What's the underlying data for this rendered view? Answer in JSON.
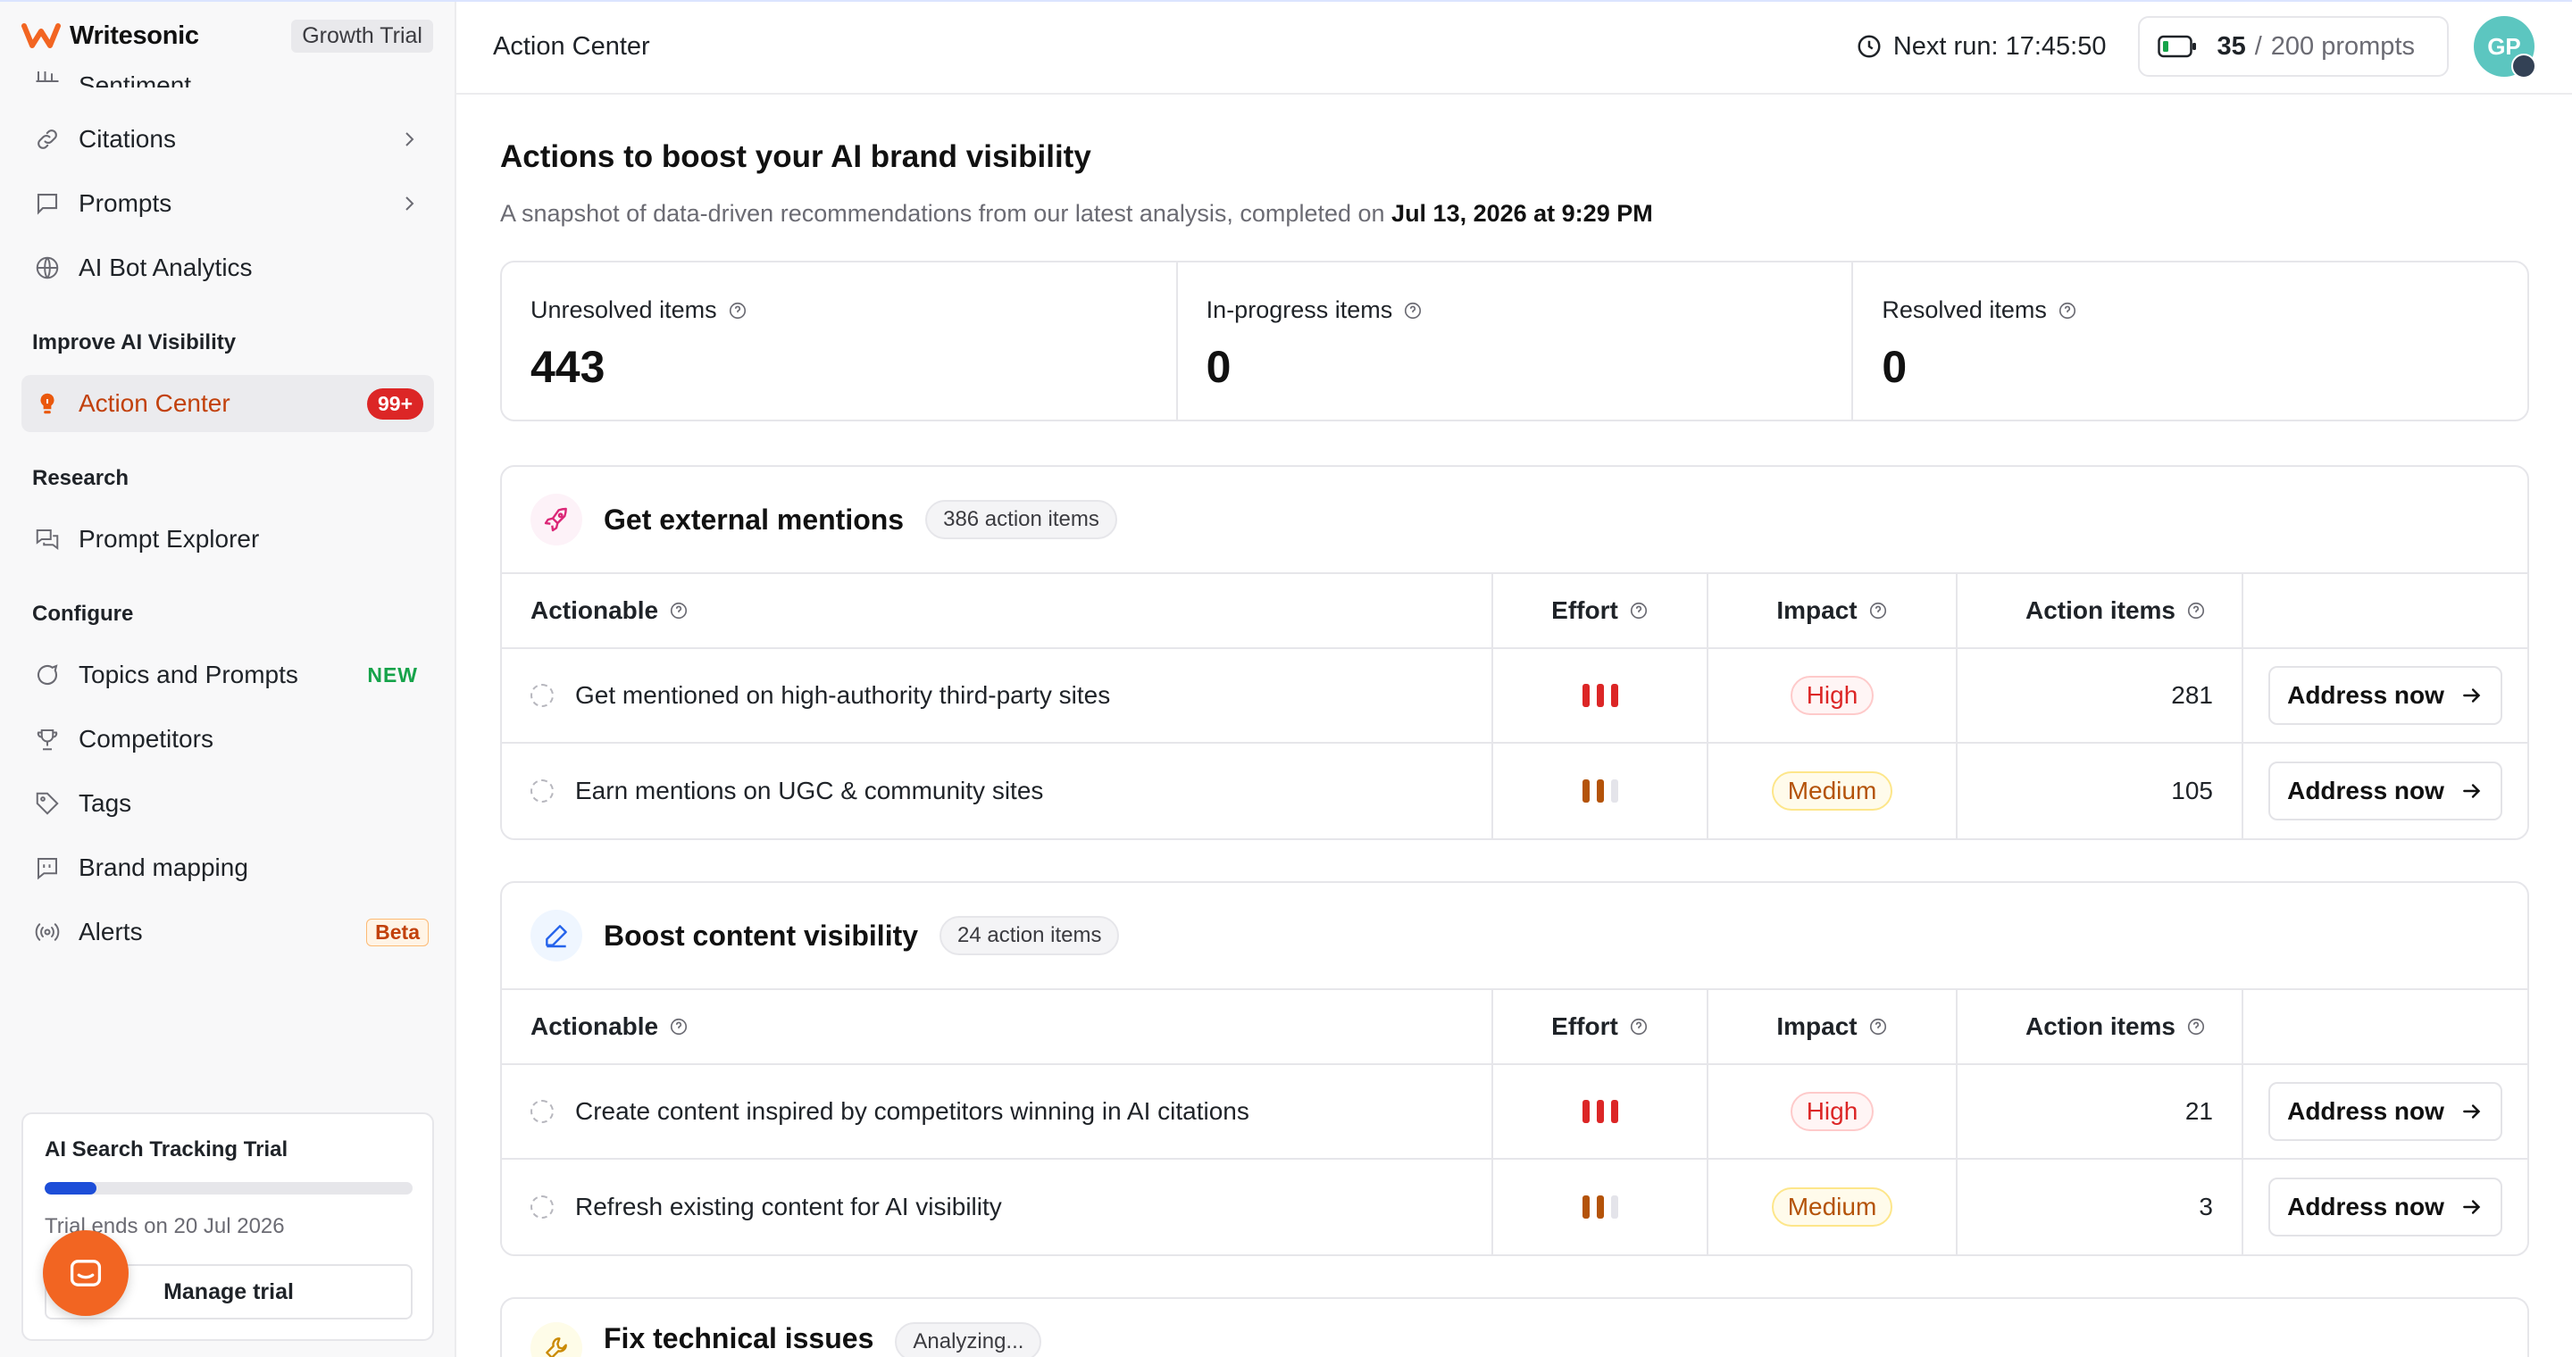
{
  "brand": {
    "name": "Writesonic",
    "plan": "Growth Trial",
    "accent": "#f26522"
  },
  "sidebar": {
    "items_top": [
      {
        "label": "Sentiment",
        "icon": "sentiment-icon"
      },
      {
        "label": "Citations",
        "icon": "link-icon"
      },
      {
        "label": "Prompts",
        "icon": "message-square-icon"
      },
      {
        "label": "AI Bot Analytics",
        "icon": "globe-icon"
      }
    ],
    "sections": {
      "improve": "Improve AI Visibility",
      "research": "Research",
      "configure": "Configure"
    },
    "action_center": {
      "label": "Action Center",
      "badge": "99+"
    },
    "prompt_explorer": {
      "label": "Prompt Explorer"
    },
    "configure_items": {
      "topics": {
        "label": "Topics and Prompts",
        "tag": "NEW"
      },
      "competitors": {
        "label": "Competitors"
      },
      "tags": {
        "label": "Tags"
      },
      "brand_mapping": {
        "label": "Brand mapping"
      },
      "alerts": {
        "label": "Alerts",
        "tag": "Beta"
      }
    },
    "trial": {
      "title": "AI Search Tracking Trial",
      "progress": 0.14,
      "ends": "Trial ends on 20 Jul 2026",
      "button": "Manage trial"
    }
  },
  "topbar": {
    "title": "Action Center",
    "next_run": "Next run: 17:45:50",
    "prompts_used": "35",
    "prompts_sep": "/",
    "prompts_total": "200 prompts",
    "avatar_initials": "GP"
  },
  "main": {
    "heading": "Actions to boost your AI brand visibility",
    "subtitle": "A snapshot of data-driven recommendations from our latest analysis, completed on",
    "completed_on": "Jul 13, 2026 at 9:29 PM",
    "stats": [
      {
        "label": "Unresolved items",
        "value": "443"
      },
      {
        "label": "In-progress items",
        "value": "0"
      },
      {
        "label": "Resolved items",
        "value": "0"
      }
    ],
    "table_headers": {
      "actionable": "Actionable",
      "effort": "Effort",
      "impact": "Impact",
      "action_items": "Action items"
    },
    "address_label": "Address now",
    "groups": [
      {
        "title": "Get external mentions",
        "count": "386 action items",
        "rows": [
          {
            "text": "Get mentioned on high-authority third-party sites",
            "effort": 3,
            "impact": "High",
            "items": "281"
          },
          {
            "text": "Earn mentions on UGC & community sites",
            "effort": 2,
            "impact": "Medium",
            "items": "105"
          }
        ]
      },
      {
        "title": "Boost content visibility",
        "count": "24 action items",
        "rows": [
          {
            "text": "Create content inspired by competitors winning in AI citations",
            "effort": 3,
            "impact": "High",
            "items": "21"
          },
          {
            "text": "Refresh existing content for AI visibility",
            "effort": 2,
            "impact": "Medium",
            "items": "3"
          }
        ]
      },
      {
        "title": "Fix technical issues",
        "count": "Analyzing..."
      }
    ]
  }
}
